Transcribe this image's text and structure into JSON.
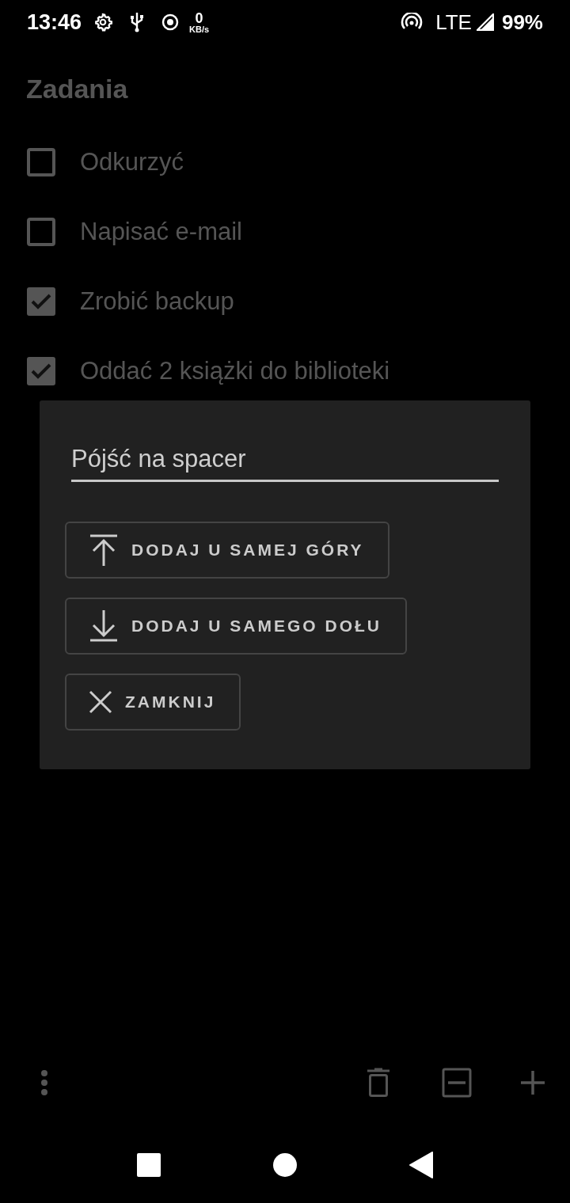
{
  "status_bar": {
    "time": "13:46",
    "speed_value": "0",
    "speed_unit": "KB/s",
    "network": "LTE",
    "battery": "99%"
  },
  "title": "Zadania",
  "tasks": [
    {
      "label": "Odkurzyć",
      "checked": false
    },
    {
      "label": "Napisać e-mail",
      "checked": false
    },
    {
      "label": "Zrobić backup",
      "checked": true
    },
    {
      "label": "Oddać 2 książki do biblioteki",
      "checked": true
    }
  ],
  "dialog": {
    "input_value": "Pójść na spacer",
    "buttons": [
      {
        "kind": "top",
        "label": "DODAJ U SAMEJ GÓRY"
      },
      {
        "kind": "bottom",
        "label": "DODAJ U SAMEGO DOŁU"
      },
      {
        "kind": "close",
        "label": "ZAMKNIJ"
      }
    ]
  }
}
